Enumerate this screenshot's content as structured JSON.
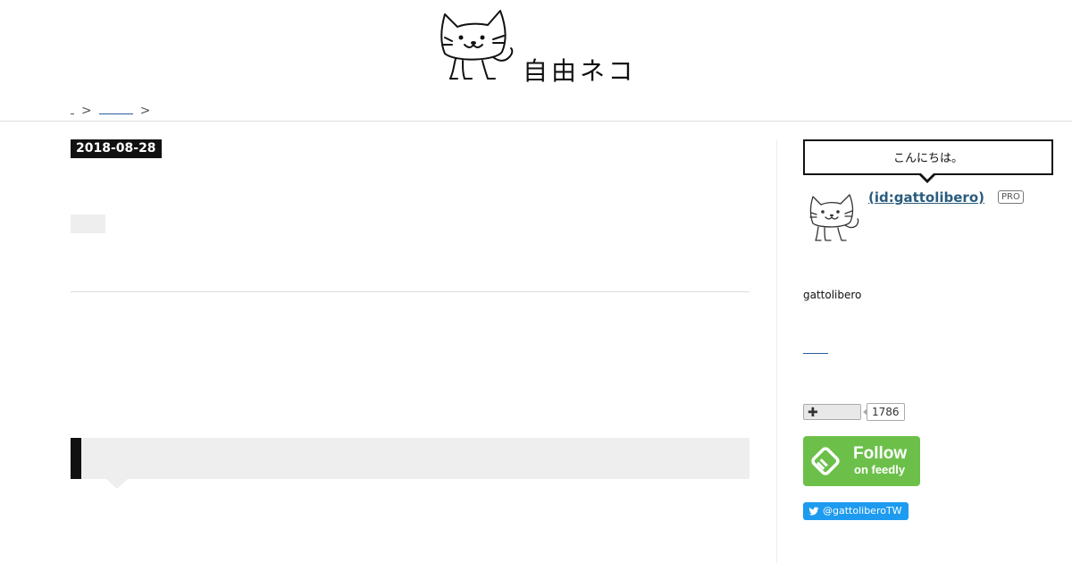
{
  "header": {
    "site_title": "自由ネコ"
  },
  "breadcrumb": {
    "sep1": ">",
    "sep2": ">"
  },
  "entry": {
    "date": "2018-08-28"
  },
  "sidebar": {
    "greeting": "こんにちは。",
    "profile": {
      "name": " (id:gattolibero)",
      "badge": "PRO",
      "description": "gattolibero"
    },
    "subscribe": {
      "icon": "plus-icon",
      "count": "1786"
    },
    "feedly": {
      "line1": "Follow",
      "line2": "on feedly",
      "color": "#6cc04a"
    },
    "twitter": {
      "label": "@gattoliberoTW",
      "color": "#1d9bf0"
    }
  }
}
